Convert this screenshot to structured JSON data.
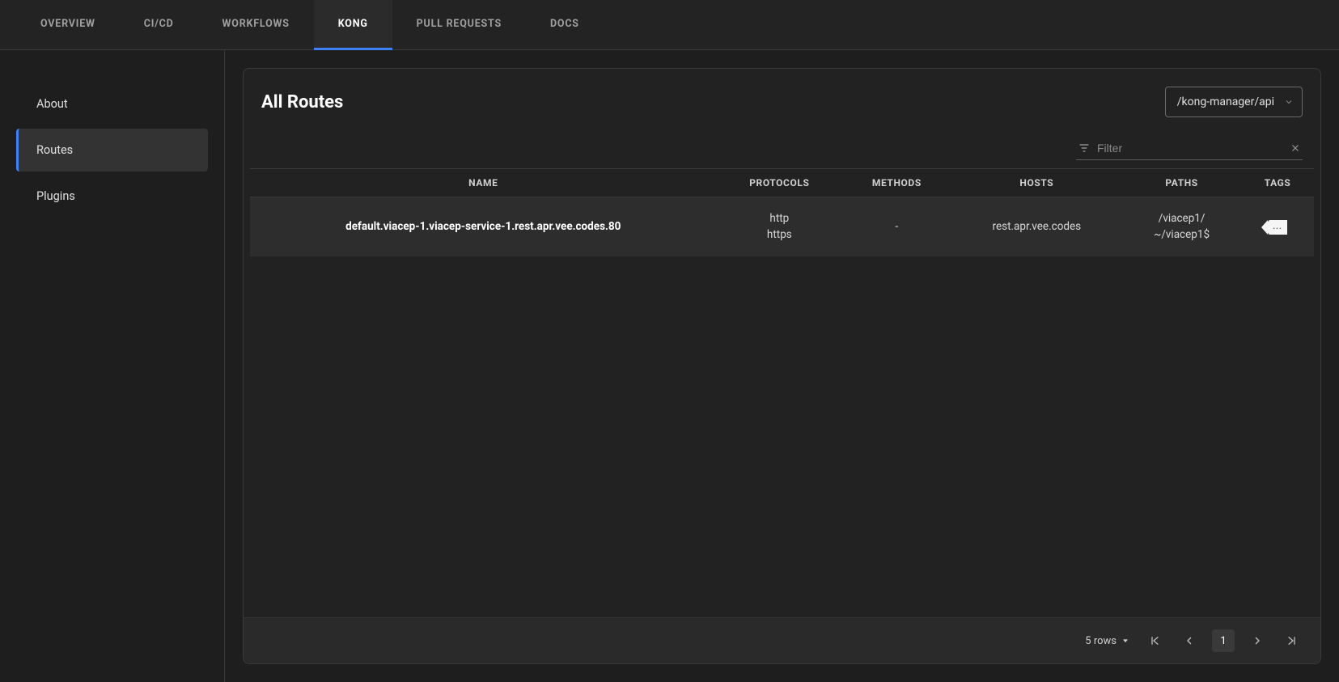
{
  "topnav": {
    "tabs": [
      {
        "label": "Overview",
        "active": false
      },
      {
        "label": "CI/CD",
        "active": false
      },
      {
        "label": "Workflows",
        "active": false
      },
      {
        "label": "Kong",
        "active": true
      },
      {
        "label": "Pull Requests",
        "active": false
      },
      {
        "label": "Docs",
        "active": false
      }
    ]
  },
  "sidebar": {
    "items": [
      {
        "label": "About",
        "active": false
      },
      {
        "label": "Routes",
        "active": true
      },
      {
        "label": "Plugins",
        "active": false
      }
    ]
  },
  "header": {
    "title": "All Routes",
    "selector_value": "/kong-manager/api"
  },
  "filter": {
    "placeholder": "Filter",
    "value": ""
  },
  "table": {
    "columns": [
      "Name",
      "Protocols",
      "Methods",
      "Hosts",
      "Paths",
      "Tags"
    ],
    "rows": [
      {
        "name": "default.viacep-1.viacep-service-1.rest.apr.vee.codes.80",
        "protocols": "http\nhttps",
        "methods": "-",
        "hosts": "rest.apr.vee.codes",
        "paths": "/viacep1/\n~/viacep1$",
        "tags_badge": "..."
      }
    ]
  },
  "pagination": {
    "rows_label": "5 rows",
    "current_page": "1"
  }
}
